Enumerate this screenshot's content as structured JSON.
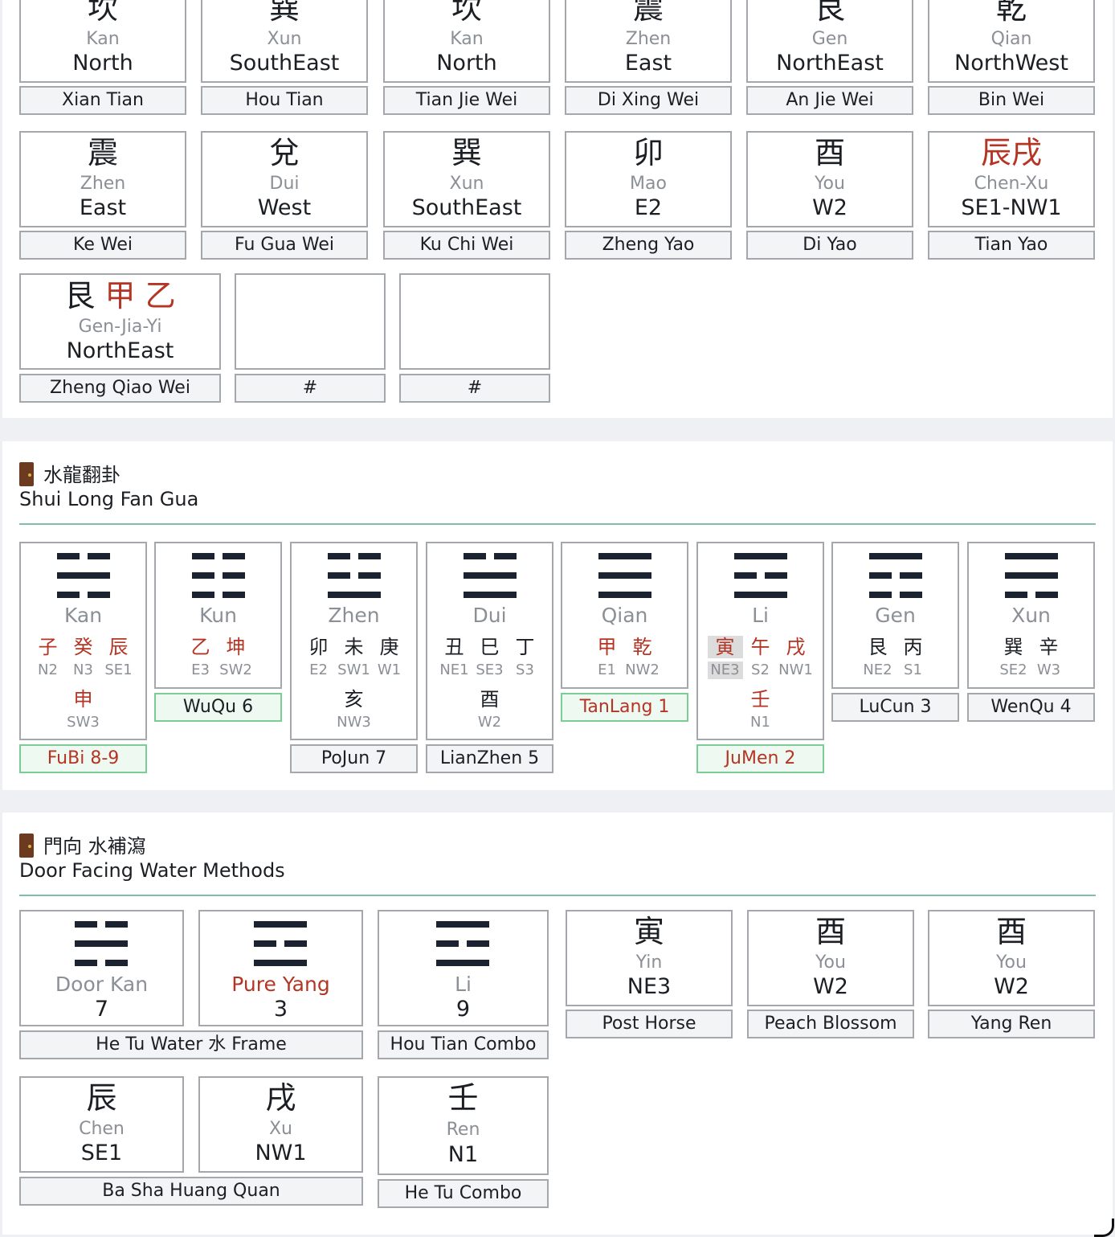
{
  "fei_xing": {
    "row1": [
      {
        "char": "坎",
        "pinyin": "Kan",
        "dir": "North",
        "caption": "Xian Tian"
      },
      {
        "char": "巽",
        "pinyin": "Xun",
        "dir": "SouthEast",
        "caption": "Hou Tian"
      },
      {
        "char": "坎",
        "pinyin": "Kan",
        "dir": "North",
        "caption": "Tian Jie Wei"
      },
      {
        "char": "震",
        "pinyin": "Zhen",
        "dir": "East",
        "caption": "Di Xing Wei"
      },
      {
        "char": "艮",
        "pinyin": "Gen",
        "dir": "NorthEast",
        "caption": "An Jie Wei"
      },
      {
        "char": "乾",
        "pinyin": "Qian",
        "dir": "NorthWest",
        "caption": "Bin Wei"
      }
    ],
    "row2": [
      {
        "char": "震",
        "pinyin": "Zhen",
        "dir": "East",
        "caption": "Ke Wei"
      },
      {
        "char": "兌",
        "pinyin": "Dui",
        "dir": "West",
        "caption": "Fu Gua Wei"
      },
      {
        "char": "巽",
        "pinyin": "Xun",
        "dir": "SouthEast",
        "caption": "Ku Chi Wei"
      },
      {
        "char": "卯",
        "pinyin": "Mao",
        "dir": "E2",
        "caption": "Zheng Yao"
      },
      {
        "char": "酉",
        "pinyin": "You",
        "dir": "W2",
        "caption": "Di Yao"
      },
      {
        "char": "辰戌",
        "pinyin": "Chen-Xu",
        "dir": "SE1-NW1",
        "caption": "Tian Yao"
      }
    ],
    "row3": [
      {
        "char_a": "艮",
        "char_b": "甲",
        "char_c": "乙",
        "pinyin": "Gen-Jia-Yi",
        "dir": "NorthEast",
        "caption": "Zheng Qiao Wei"
      },
      {
        "caption": "#"
      },
      {
        "caption": "#"
      }
    ]
  },
  "shui_long": {
    "title_cn": "水龍翻卦",
    "title_en": "Shui Long Fan Gua",
    "trigrams": [
      {
        "name": "Kan",
        "lines": [
          "broken",
          "solid",
          "broken"
        ],
        "branches": [
          {
            "c": "子",
            "red": true
          },
          {
            "c": "癸",
            "red": true
          },
          {
            "c": "辰",
            "red": true
          }
        ],
        "sectors": [
          "N2",
          "N3",
          "SE1"
        ],
        "extra_char": "申",
        "extra_red": true,
        "extra_sector": "SW3",
        "star": "FuBi 8-9",
        "star_green": true,
        "star_red": true
      },
      {
        "name": "Kun",
        "lines": [
          "broken",
          "broken",
          "broken"
        ],
        "branches": [
          {
            "c": "乙",
            "red": true
          },
          {
            "c": "坤",
            "red": true
          }
        ],
        "sectors": [
          "E3",
          "SW2"
        ],
        "star": "WuQu 6",
        "star_green": true,
        "star_red": false
      },
      {
        "name": "Zhen",
        "lines": [
          "broken",
          "broken",
          "solid"
        ],
        "branches": [
          {
            "c": "卯"
          },
          {
            "c": "未"
          },
          {
            "c": "庚"
          }
        ],
        "sectors": [
          "E2",
          "SW1",
          "W1"
        ],
        "extra_char": "亥",
        "extra_red": false,
        "extra_sector": "NW3",
        "star": "PoJun 7",
        "star_green": false,
        "star_red": false
      },
      {
        "name": "Dui",
        "lines": [
          "broken",
          "solid",
          "solid"
        ],
        "branches": [
          {
            "c": "丑"
          },
          {
            "c": "巳"
          },
          {
            "c": "丁"
          }
        ],
        "sectors": [
          "NE1",
          "SE3",
          "S3"
        ],
        "extra_char": "酉",
        "extra_red": false,
        "extra_sector": "W2",
        "star": "LianZhen 5",
        "star_green": false,
        "star_red": false
      },
      {
        "name": "Qian",
        "lines": [
          "solid",
          "solid",
          "solid"
        ],
        "branches": [
          {
            "c": "甲",
            "red": true
          },
          {
            "c": "乾",
            "red": true
          }
        ],
        "sectors": [
          "E1",
          "NW2"
        ],
        "star": "TanLang 1",
        "star_green": true,
        "star_red": true
      },
      {
        "name": "Li",
        "lines": [
          "solid",
          "broken",
          "solid"
        ],
        "branches": [
          {
            "c": "寅",
            "red": true,
            "hl": true
          },
          {
            "c": "午",
            "red": true
          },
          {
            "c": "戌",
            "red": true
          }
        ],
        "sectors": [
          "NE3",
          "S2",
          "NW1"
        ],
        "sector_hl": 0,
        "extra_char": "壬",
        "extra_red": true,
        "extra_sector": "N1",
        "star": "JuMen 2",
        "star_green": true,
        "star_red": true
      },
      {
        "name": "Gen",
        "lines": [
          "solid",
          "broken",
          "broken"
        ],
        "branches": [
          {
            "c": "艮"
          },
          {
            "c": "丙"
          }
        ],
        "sectors": [
          "NE2",
          "S1"
        ],
        "star": "LuCun 3",
        "star_green": false,
        "star_red": false
      },
      {
        "name": "Xun",
        "lines": [
          "solid",
          "solid",
          "broken"
        ],
        "branches": [
          {
            "c": "巽"
          },
          {
            "c": "辛"
          }
        ],
        "sectors": [
          "SE2",
          "W3"
        ],
        "star": "WenQu 4",
        "star_green": false,
        "star_red": false
      }
    ]
  },
  "door_water": {
    "title_cn": "門向 水補瀉",
    "title_en": "Door Facing Water Methods",
    "he_tu": {
      "cells": [
        {
          "lines": [
            "broken",
            "solid",
            "broken"
          ],
          "label": "Door Kan",
          "label_red": false,
          "num": "7"
        },
        {
          "lines": [
            "solid",
            "broken",
            "solid"
          ],
          "label": "Pure Yang",
          "label_red": true,
          "num": "3"
        }
      ],
      "caption": "He Tu Water 水 Frame"
    },
    "hou_tian": {
      "lines": [
        "solid",
        "broken",
        "solid"
      ],
      "label": "Li",
      "num": "9",
      "caption": "Hou Tian Combo"
    },
    "singles": [
      {
        "char": "寅",
        "pinyin": "Yin",
        "dir": "NE3",
        "caption": "Post Horse"
      },
      {
        "char": "酉",
        "pinyin": "You",
        "dir": "W2",
        "caption": "Peach Blossom"
      },
      {
        "char": "酉",
        "pinyin": "You",
        "dir": "W2",
        "caption": "Yang Ren"
      }
    ],
    "ba_sha": {
      "cells": [
        {
          "char": "辰",
          "pinyin": "Chen",
          "dir": "SE1"
        },
        {
          "char": "戌",
          "pinyin": "Xu",
          "dir": "NW1"
        }
      ],
      "caption": "Ba Sha Huang Quan"
    },
    "he_tu_combo": {
      "char": "壬",
      "pinyin": "Ren",
      "dir": "N1",
      "caption": "He Tu Combo"
    }
  }
}
